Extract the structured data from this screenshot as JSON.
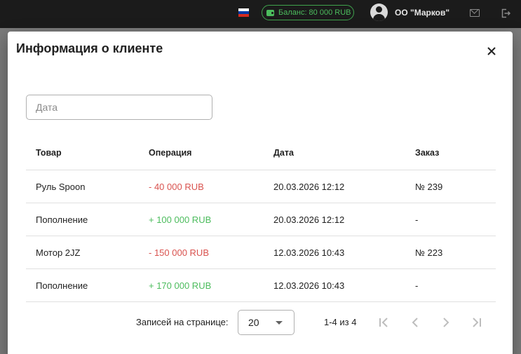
{
  "topbar": {
    "balance_text": "Баланс: 80 000 RUB",
    "account_name": "ОО \"Марков\"",
    "flag_colors": [
      "#ffffff",
      "#0039a6",
      "#d52b1e"
    ]
  },
  "modal": {
    "title": "Информация о клиенте",
    "date_placeholder": "Дата",
    "columns": [
      "Товар",
      "Операция",
      "Дата",
      "Заказ"
    ],
    "rows": [
      {
        "product": "Руль Spoon",
        "operation": "- 40 000 RUB",
        "type": "debit",
        "date": "20.03.2026 12:12",
        "order": "№ 239"
      },
      {
        "product": "Пополнение",
        "operation": "+ 100 000 RUB",
        "type": "credit",
        "date": "20.03.2026 12:12",
        "order": "-"
      },
      {
        "product": "Мотор 2JZ",
        "operation": "- 150 000 RUB",
        "type": "debit",
        "date": "12.03.2026 10:43",
        "order": "№ 223"
      },
      {
        "product": "Пополнение",
        "operation": "+ 170 000 RUB",
        "type": "credit",
        "date": "12.03.2026 10:43",
        "order": "-"
      }
    ],
    "pagination": {
      "rows_per_page_label": "Записей на странице:",
      "rows_per_page": "20",
      "range": "1-4 из 4"
    }
  },
  "icons": [
    "wallet-icon",
    "user-avatar-icon",
    "mail-icon",
    "logout-icon",
    "close-icon",
    "chevron-down-icon",
    "first-page-icon",
    "prev-page-icon",
    "next-page-icon",
    "last-page-icon"
  ],
  "colors": {
    "accent_green": "#4cbc5d",
    "debit_red": "#d9534f",
    "topbar": "#1b1b1b"
  }
}
